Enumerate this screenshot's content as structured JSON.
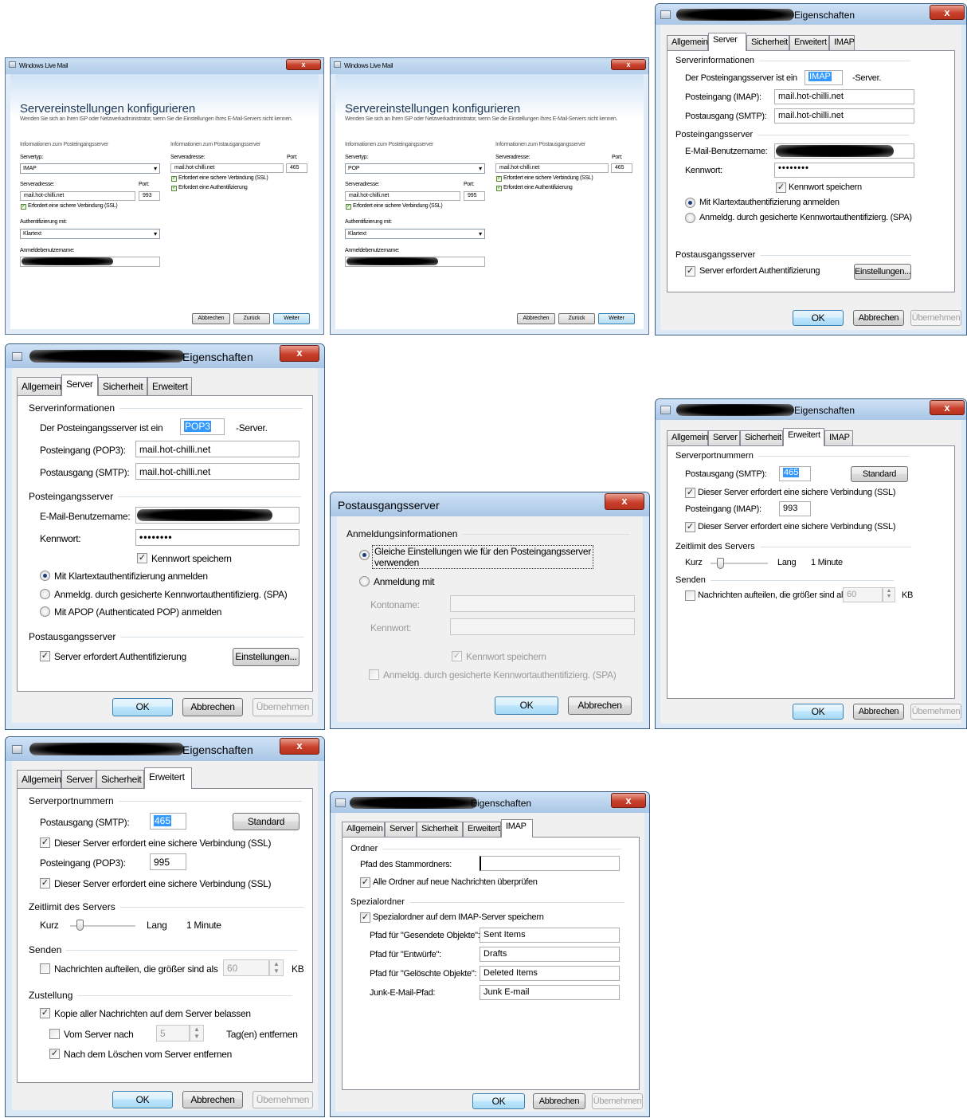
{
  "wlm_imap": {
    "title": "Windows Live Mail",
    "heading": "Servereinstellungen konfigurieren",
    "intro": "Wenden Sie sich an Ihren ISP oder Netzwerkadministrator, wenn Sie die Einstellungen Ihres E-Mail-Servers nicht kennen.",
    "in_header": "Informationen zum Posteingangsserver",
    "servertype_label": "Servertyp:",
    "servertype": "IMAP",
    "in_addr_label": "Serveradresse:",
    "in_port_label": "Port:",
    "in_addr": "mail.hot-chilli.net",
    "in_port": "993",
    "in_ssl": "Erfordert eine sichere Verbindung (SSL)",
    "auth_label": "Authentifizierung mit:",
    "auth": "Klartext",
    "user_label": "Anmeldebenutzername:",
    "out_header": "Informationen zum Postausgangsserver",
    "out_addr_label": "Serveradresse:",
    "out_port_label": "Port:",
    "out_addr": "mail.hot-chilli.net",
    "out_port": "465",
    "out_ssl": "Erfordert eine sichere Verbindung (SSL)",
    "out_auth": "Erfordert eine Authentifizierung",
    "cancel": "Abbrechen",
    "back": "Zurück",
    "next": "Weiter"
  },
  "wlm_pop": {
    "title": "Windows Live Mail",
    "heading": "Servereinstellungen konfigurieren",
    "intro": "Wenden Sie sich an Ihren ISP oder Netzwerkadministrator, wenn Sie die Einstellungen Ihres E-Mail-Servers nicht kennen.",
    "in_header": "Informationen zum Posteingangsserver",
    "servertype_label": "Servertyp:",
    "servertype": "POP",
    "in_addr_label": "Serveradresse:",
    "in_port_label": "Port:",
    "in_addr": "mail.hot-chilli.net",
    "in_port": "995",
    "in_ssl": "Erfordert eine sichere Verbindung (SSL)",
    "auth_label": "Authentifizierung mit:",
    "auth": "Klartext",
    "user_label": "Anmeldebenutzername:",
    "out_header": "Informationen zum Postausgangsserver",
    "out_addr_label": "Serveradresse:",
    "out_port_label": "Port:",
    "out_addr": "mail.hot-chilli.net",
    "out_port": "465",
    "out_ssl": "Erfordert eine sichere Verbindung (SSL)",
    "out_auth": "Erfordert eine Authentifizierung",
    "cancel": "Abbrechen",
    "back": "Zurück",
    "next": "Weiter"
  },
  "tabs": {
    "general": "Allgemein",
    "server": "Server",
    "security": "Sicherheit",
    "advanced": "Erweitert",
    "imap": "IMAP"
  },
  "buttons": {
    "ok": "OK",
    "cancel": "Abbrechen",
    "apply": "Übernehmen",
    "settings": "Einstellungen...",
    "standard": "Standard"
  },
  "props_title": "Eigenschaften",
  "srv_imap": {
    "grp_info": "Serverinformationen",
    "in_type_label": "Der Posteingangsserver ist ein",
    "in_type": "IMAP",
    "server_suffix": "-Server.",
    "in_label": "Posteingang (IMAP):",
    "in_value": "mail.hot-chilli.net",
    "out_label": "Postausgang (SMTP):",
    "out_value": "mail.hot-chilli.net",
    "grp_in": "Posteingangsserver",
    "user_label": "E-Mail-Benutzername:",
    "pass_label": "Kennwort:",
    "password": "••••••••",
    "save_pw": "Kennwort speichern",
    "plain": "Mit Klartextauthentifizierung anmelden",
    "spa": "Anmeldg. durch gesicherte Kennwortauthentifizierg. (SPA)",
    "grp_out": "Postausgangsserver",
    "out_auth": "Server erfordert Authentifizierung"
  },
  "srv_pop": {
    "grp_info": "Serverinformationen",
    "in_type_label": "Der Posteingangsserver ist ein",
    "in_type": "POP3",
    "server_suffix": "-Server.",
    "in_label": "Posteingang (POP3):",
    "in_value": "mail.hot-chilli.net",
    "out_label": "Postausgang (SMTP):",
    "out_value": "mail.hot-chilli.net",
    "grp_in": "Posteingangsserver",
    "user_label": "E-Mail-Benutzername:",
    "pass_label": "Kennwort:",
    "password": "••••••••",
    "save_pw": "Kennwort speichern",
    "plain": "Mit Klartextauthentifizierung anmelden",
    "spa": "Anmeldg. durch gesicherte Kennwortauthentifizierg. (SPA)",
    "apop": "Mit APOP (Authenticated POP) anmelden",
    "grp_out": "Postausgangsserver",
    "out_auth": "Server erfordert Authentifizierung"
  },
  "outgoing": {
    "title": "Postausgangsserver",
    "grp": "Anmeldungsinformationen",
    "same": "Gleiche Einstellungen wie für den Posteingangsserver verwenden",
    "same_1": "Gleiche Einstellungen wie für den Posteingangsserver",
    "same_2": "verwenden",
    "login_with": "Anmeldung mit",
    "account_label": "Kontoname:",
    "pass_label": "Kennwort:",
    "save_pw": "Kennwort speichern",
    "spa": "Anmeldg. durch gesicherte Kennwortauthentifizierg. (SPA)"
  },
  "adv_imap": {
    "grp_ports": "Serverportnummern",
    "out_label": "Postausgang (SMTP):",
    "out_port": "465",
    "ssl1": "Dieser Server erfordert eine sichere Verbindung (SSL)",
    "in_label": "Posteingang (IMAP):",
    "in_port": "993",
    "ssl2": "Dieser Server erfordert eine sichere Verbindung (SSL)",
    "grp_timeout": "Zeitlimit des Servers",
    "short": "Kurz",
    "long": "Lang",
    "timeout": "1 Minute",
    "grp_send": "Senden",
    "split": "Nachrichten aufteilen, die größer sind als",
    "split_value": "60",
    "kb": "KB"
  },
  "adv_pop": {
    "grp_ports": "Serverportnummern",
    "out_label": "Postausgang (SMTP):",
    "out_port": "465",
    "ssl1": "Dieser Server erfordert eine sichere Verbindung (SSL)",
    "in_label": "Posteingang (POP3):",
    "in_port": "995",
    "ssl2": "Dieser Server erfordert eine sichere Verbindung (SSL)",
    "grp_timeout": "Zeitlimit des Servers",
    "short": "Kurz",
    "long": "Lang",
    "timeout": "1 Minute",
    "grp_send": "Senden",
    "split": "Nachrichten aufteilen, die größer sind als",
    "split_value": "60",
    "kb": "KB",
    "grp_delivery": "Zustellung",
    "keep_copy": "Kopie aller Nachrichten auf dem Server belassen",
    "remove_after": "Vom Server nach",
    "days": "5",
    "days_suffix": "Tag(en) entfernen",
    "remove_on_delete": "Nach dem Löschen vom Server entfernen"
  },
  "imap_tab": {
    "grp_folders": "Ordner",
    "root_label": "Pfad des Stammordners:",
    "root_value": "",
    "check_all": "Alle Ordner auf neue Nachrichten überprüfen",
    "grp_special": "Spezialordner",
    "store": "Spezialordner auf dem IMAP-Server speichern",
    "sent_label": "Pfad für \"Gesendete Objekte\":",
    "sent": "Sent Items",
    "drafts_label": "Pfad für \"Entwürfe\":",
    "drafts": "Drafts",
    "deleted_label": "Pfad für \"Gelöschte Objekte\":",
    "deleted": "Deleted Items",
    "junk_label": "Junk-E-Mail-Pfad:",
    "junk": "Junk E-mail"
  }
}
